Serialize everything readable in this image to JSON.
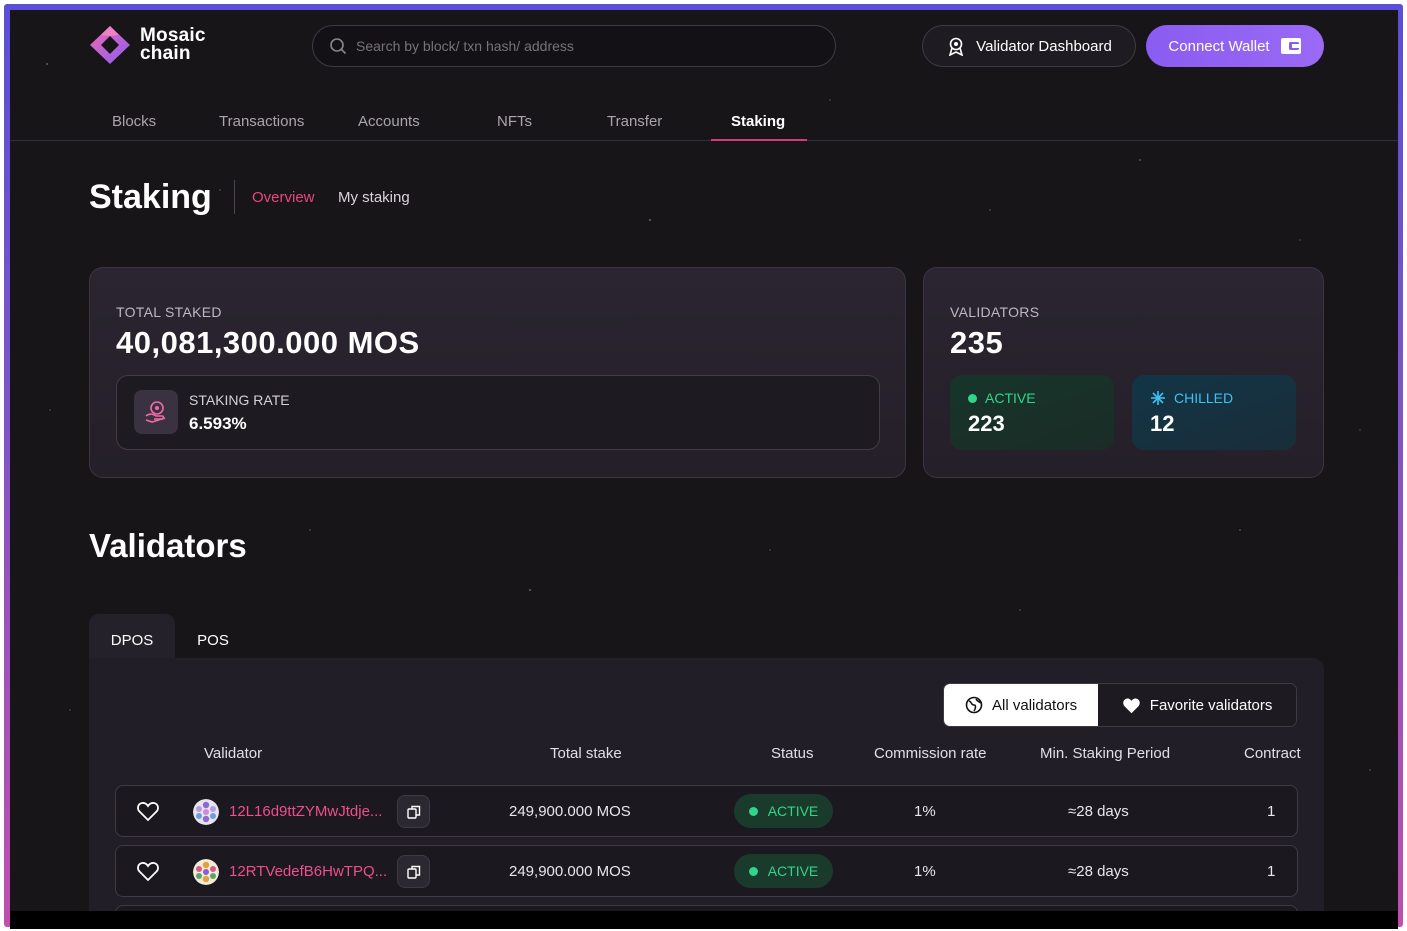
{
  "brand": {
    "name_line1": "Mosaic",
    "name_line2": "chain"
  },
  "search": {
    "placeholder": "Search by block/ txn hash/ address"
  },
  "header": {
    "validator_dashboard": "Validator Dashboard",
    "connect_wallet": "Connect Wallet"
  },
  "nav": [
    "Blocks",
    "Transactions",
    "Accounts",
    "NFTs",
    "Transfer",
    "Staking"
  ],
  "nav_active": "Staking",
  "page": {
    "title": "Staking",
    "sub_tabs": [
      "Overview",
      "My staking"
    ],
    "sub_tab_active": "Overview"
  },
  "total_staked": {
    "label": "TOTAL STAKED",
    "value": "40,081,300.000 MOS",
    "rate_label": "STAKING RATE",
    "rate_value": "6.593%"
  },
  "validators_summary": {
    "label": "VALIDATORS",
    "value": "235",
    "active_label": "ACTIVE",
    "active_value": "223",
    "chilled_label": "CHILLED",
    "chilled_value": "12"
  },
  "validators": {
    "title": "Validators",
    "tabs": [
      "DPOS",
      "POS"
    ],
    "tab_active": "DPOS",
    "filters": {
      "all": "All validators",
      "favorite": "Favorite validators"
    },
    "columns": [
      "Validator",
      "Total stake",
      "Status",
      "Commission rate",
      "Min. Staking Period",
      "Contract"
    ],
    "rows": [
      {
        "address": "12L16d9ttZYMwJtdje...",
        "total_stake": "249,900.000 MOS",
        "status": "ACTIVE",
        "commission": "1%",
        "period": "≈28 days",
        "contract": "1"
      },
      {
        "address": "12RTVedefB6HwTPQ...",
        "total_stake": "249,900.000 MOS",
        "status": "ACTIVE",
        "commission": "1%",
        "period": "≈28 days",
        "contract": "1"
      }
    ]
  },
  "colors": {
    "accent_pink": "#e8467c",
    "connect_purple": "#8a5cf0",
    "active_green": "#2fd58a",
    "chilled_blue": "#3fc0f0",
    "background": "#181519"
  },
  "icons": [
    "logo-icon",
    "search-icon",
    "validator-badge-icon",
    "wallet-icon",
    "staking-hand-icon",
    "snowflake-icon",
    "globe-icon",
    "heart-icon",
    "copy-icon",
    "avatar-icon"
  ]
}
